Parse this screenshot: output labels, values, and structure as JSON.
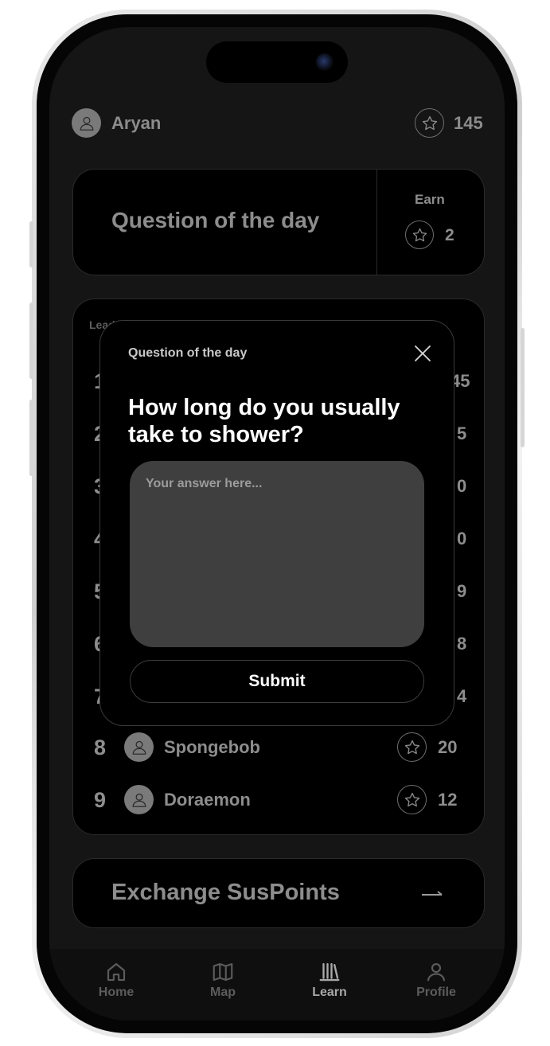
{
  "header": {
    "user_name": "Aryan",
    "points": "145"
  },
  "qotd_card": {
    "title": "Question of the day",
    "earn_label": "Earn",
    "earn_value": "2"
  },
  "leaderboard": {
    "title": "Leaderboard",
    "rows": [
      {
        "rank": "1",
        "points_fragment": "45"
      },
      {
        "rank": "2",
        "points_fragment": "5"
      },
      {
        "rank": "3",
        "points_fragment": "0"
      },
      {
        "rank": "4",
        "points_fragment": "0"
      },
      {
        "rank": "5",
        "points_fragment": "9"
      },
      {
        "rank": "6",
        "points_fragment": "8"
      },
      {
        "rank": "7",
        "points_fragment": "4"
      },
      {
        "rank": "8",
        "name": "Spongebob",
        "points": "20"
      },
      {
        "rank": "9",
        "name": "Doraemon",
        "points": "12"
      }
    ]
  },
  "exchange": {
    "label": "Exchange SusPoints",
    "arrow": "→"
  },
  "tabs": [
    {
      "label": "Home",
      "icon": "home-icon",
      "active": false
    },
    {
      "label": "Map",
      "icon": "map-icon",
      "active": false
    },
    {
      "label": "Learn",
      "icon": "learn-icon",
      "active": true
    },
    {
      "label": "Profile",
      "icon": "profile-icon",
      "active": false
    }
  ],
  "modal": {
    "kicker": "Question of the day",
    "question": "How long do you usually take to shower?",
    "answer_placeholder": "Your answer here...",
    "answer_value": "",
    "submit_label": "Submit"
  },
  "colors": {
    "screen_bg": "#151515",
    "card_bg": "#000000",
    "text_muted": "#8d8d8d",
    "text_strong": "#ffffff",
    "input_bg": "#3f3f3f"
  }
}
